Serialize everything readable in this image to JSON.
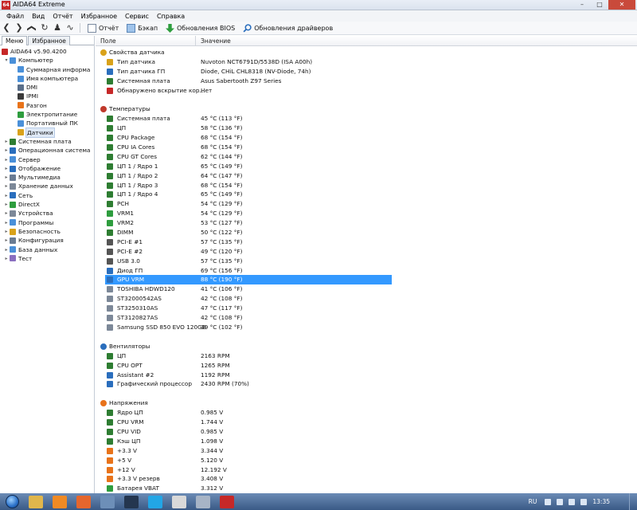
{
  "window": {
    "app_icon_text": "64",
    "title": "AIDA64 Extreme",
    "buttons": {
      "minimize": "–",
      "maximize": "□",
      "close": "✕"
    }
  },
  "menu": [
    "Файл",
    "Вид",
    "Отчёт",
    "Избранное",
    "Сервис",
    "Справка"
  ],
  "toolbar": {
    "nav": [
      "❮",
      "❯",
      "❯",
      "↻",
      "♟",
      "∿"
    ],
    "report": "Отчёт",
    "backup": "Бэкап",
    "bios_updates": "Обновления BIOS",
    "driver_updates": "Обновления драйверов"
  },
  "tabs": [
    "Меню",
    "Избранное"
  ],
  "tree": [
    {
      "label": "AIDA64 v5.90.4200",
      "depth": 0,
      "icon": "aida-icon",
      "color": "#c62828",
      "exp": ""
    },
    {
      "label": "Компьютер",
      "depth": 1,
      "icon": "computer-icon",
      "color": "#4a90d9",
      "exp": "▾"
    },
    {
      "label": "Суммарная информа",
      "depth": 2,
      "icon": "summary-icon",
      "color": "#4a90d9",
      "exp": ""
    },
    {
      "label": "Имя компьютера",
      "depth": 2,
      "icon": "computer-name-icon",
      "color": "#4a90d9",
      "exp": ""
    },
    {
      "label": "DMI",
      "depth": 2,
      "icon": "dmi-icon",
      "color": "#5a6f8a",
      "exp": ""
    },
    {
      "label": "IPMI",
      "depth": 2,
      "icon": "ipmi-icon",
      "color": "#3b3b3b",
      "exp": ""
    },
    {
      "label": "Разгон",
      "depth": 2,
      "icon": "flame-icon",
      "color": "#e8731a",
      "exp": ""
    },
    {
      "label": "Электропитание",
      "depth": 2,
      "icon": "power-icon",
      "color": "#2e9d3e",
      "exp": ""
    },
    {
      "label": "Портативный ПК",
      "depth": 2,
      "icon": "laptop-icon",
      "color": "#4a90d9",
      "exp": ""
    },
    {
      "label": "Датчики",
      "depth": 2,
      "icon": "sensor-icon",
      "color": "#d9a21a",
      "exp": "",
      "selected": true
    },
    {
      "label": "Системная плата",
      "depth": 1,
      "icon": "motherboard-icon",
      "color": "#2e7d32",
      "exp": "▸"
    },
    {
      "label": "Операционная система",
      "depth": 1,
      "icon": "os-icon",
      "color": "#2a6ebd",
      "exp": "▸"
    },
    {
      "label": "Сервер",
      "depth": 1,
      "icon": "server-icon",
      "color": "#4a90d9",
      "exp": "▸"
    },
    {
      "label": "Отображение",
      "depth": 1,
      "icon": "display-icon",
      "color": "#2a6ebd",
      "exp": "▸"
    },
    {
      "label": "Мультимедиа",
      "depth": 1,
      "icon": "multimedia-icon",
      "color": "#6a7c93",
      "exp": "▸"
    },
    {
      "label": "Хранение данных",
      "depth": 1,
      "icon": "storage-icon",
      "color": "#7c8898",
      "exp": "▸"
    },
    {
      "label": "Сеть",
      "depth": 1,
      "icon": "network-icon",
      "color": "#2a6ebd",
      "exp": "▸"
    },
    {
      "label": "DirectX",
      "depth": 1,
      "icon": "directx-icon",
      "color": "#2e9d3e",
      "exp": "▸"
    },
    {
      "label": "Устройства",
      "depth": 1,
      "icon": "devices-icon",
      "color": "#7c8898",
      "exp": "▸"
    },
    {
      "label": "Программы",
      "depth": 1,
      "icon": "programs-icon",
      "color": "#4a90d9",
      "exp": "▸"
    },
    {
      "label": "Безопасность",
      "depth": 1,
      "icon": "security-icon",
      "color": "#d9a21a",
      "exp": "▸"
    },
    {
      "label": "Конфигурация",
      "depth": 1,
      "icon": "config-icon",
      "color": "#6a7c93",
      "exp": "▸"
    },
    {
      "label": "База данных",
      "depth": 1,
      "icon": "database-icon",
      "color": "#4a90d9",
      "exp": "▸"
    },
    {
      "label": "Тест",
      "depth": 1,
      "icon": "test-icon",
      "color": "#8a6fc0",
      "exp": "▸"
    }
  ],
  "columns": {
    "field": "Поле",
    "value": "Значение"
  },
  "sections": [
    {
      "title": "Свойства датчика",
      "icon": "sensor-props-icon",
      "color": "#d9a21a",
      "rows": [
        {
          "field": "Тип датчика",
          "value": "Nuvoton NCT6791D/5538D  (ISA A00h)",
          "icon": "sensor-type-icon",
          "color": "#d9a21a"
        },
        {
          "field": "Тип датчика ГП",
          "value": "Diode, CHiL CHL8318  (NV-Diode, 74h)",
          "icon": "gpu-sensor-icon",
          "color": "#2a6ebd"
        },
        {
          "field": "Системная плата",
          "value": "Asus Sabertooth Z97 Series",
          "icon": "motherboard-icon",
          "color": "#2e7d32"
        },
        {
          "field": "Обнаружено вскрытие кор...",
          "value": "Нет",
          "icon": "chassis-icon",
          "color": "#c62828"
        }
      ]
    },
    {
      "title": "Температуры",
      "icon": "thermometer-icon",
      "color": "#c0392b",
      "rows": [
        {
          "field": "Системная плата",
          "value": "45 °C  (113 °F)",
          "icon": "motherboard-icon",
          "color": "#2e7d32"
        },
        {
          "field": "ЦП",
          "value": "58 °C  (136 °F)",
          "icon": "cpu-icon",
          "color": "#2e7d32"
        },
        {
          "field": "CPU Package",
          "value": "68 °C  (154 °F)",
          "icon": "cpu-icon",
          "color": "#2e7d32"
        },
        {
          "field": "CPU IA Cores",
          "value": "68 °C  (154 °F)",
          "icon": "cpu-icon",
          "color": "#2e7d32"
        },
        {
          "field": "CPU GT Cores",
          "value": "62 °C  (144 °F)",
          "icon": "cpu-icon",
          "color": "#2e7d32"
        },
        {
          "field": "ЦП 1 / Ядро 1",
          "value": "65 °C  (149 °F)",
          "icon": "cpu-icon",
          "color": "#2e7d32"
        },
        {
          "field": "ЦП 1 / Ядро 2",
          "value": "64 °C  (147 °F)",
          "icon": "cpu-icon",
          "color": "#2e7d32"
        },
        {
          "field": "ЦП 1 / Ядро 3",
          "value": "68 °C  (154 °F)",
          "icon": "cpu-icon",
          "color": "#2e7d32"
        },
        {
          "field": "ЦП 1 / Ядро 4",
          "value": "65 °C  (149 °F)",
          "icon": "cpu-icon",
          "color": "#2e7d32"
        },
        {
          "field": "PCH",
          "value": "54 °C  (129 °F)",
          "icon": "chip-icon",
          "color": "#2e7d32"
        },
        {
          "field": "VRM1",
          "value": "54 °C  (129 °F)",
          "icon": "vrm-icon",
          "color": "#2e9d3e"
        },
        {
          "field": "VRM2",
          "value": "53 °C  (127 °F)",
          "icon": "vrm-icon",
          "color": "#2e9d3e"
        },
        {
          "field": "DIMM",
          "value": "50 °C  (122 °F)",
          "icon": "memory-icon",
          "color": "#2e7d32"
        },
        {
          "field": "PCI-E #1",
          "value": "57 °C  (135 °F)",
          "icon": "pcie-icon",
          "color": "#555"
        },
        {
          "field": "PCI-E #2",
          "value": "49 °C  (120 °F)",
          "icon": "pcie-icon",
          "color": "#555"
        },
        {
          "field": "USB 3.0",
          "value": "57 °C  (135 °F)",
          "icon": "usb-icon",
          "color": "#555"
        },
        {
          "field": "Диод ГП",
          "value": "69 °C  (156 °F)",
          "icon": "gpu-icon",
          "color": "#2a6ebd"
        },
        {
          "field": "GPU VRM",
          "value": "88 °C  (190 °F)",
          "icon": "gpu-icon",
          "color": "#2a6ebd",
          "highlighted": true
        },
        {
          "field": "TOSHIBA HDWD120",
          "value": "41 °C  (106 °F)",
          "icon": "disk-icon",
          "color": "#7c8898"
        },
        {
          "field": "ST32000542AS",
          "value": "42 °C  (108 °F)",
          "icon": "disk-icon",
          "color": "#7c8898"
        },
        {
          "field": "ST3250310AS",
          "value": "47 °C  (117 °F)",
          "icon": "disk-icon",
          "color": "#7c8898"
        },
        {
          "field": "ST3120827AS",
          "value": "42 °C  (108 °F)",
          "icon": "disk-icon",
          "color": "#7c8898"
        },
        {
          "field": "Samsung SSD 850 EVO 120GB",
          "value": "39 °C  (102 °F)",
          "icon": "disk-icon",
          "color": "#7c8898"
        }
      ]
    },
    {
      "title": "Вентиляторы",
      "icon": "fan-icon",
      "color": "#2a6ebd",
      "rows": [
        {
          "field": "ЦП",
          "value": "2163 RPM",
          "icon": "cpu-icon",
          "color": "#2e7d32"
        },
        {
          "field": "CPU OPT",
          "value": "1265 RPM",
          "icon": "cpu-icon",
          "color": "#2e7d32"
        },
        {
          "field": "Assistant #2",
          "value": "1192 RPM",
          "icon": "fan-icon",
          "color": "#2a6ebd"
        },
        {
          "field": "Графический процессор",
          "value": "2430 RPM  (70%)",
          "icon": "gpu-icon",
          "color": "#2a6ebd"
        }
      ]
    },
    {
      "title": "Напряжения",
      "icon": "voltage-icon",
      "color": "#e8731a",
      "rows": [
        {
          "field": "Ядро ЦП",
          "value": "0.985 V",
          "icon": "cpu-icon",
          "color": "#2e7d32"
        },
        {
          "field": "CPU VRM",
          "value": "1.744 V",
          "icon": "cpu-icon",
          "color": "#2e7d32"
        },
        {
          "field": "CPU VID",
          "value": "0.985 V",
          "icon": "cpu-icon",
          "color": "#2e7d32"
        },
        {
          "field": "Кэш ЦП",
          "value": "1.098 V",
          "icon": "cpu-icon",
          "color": "#2e7d32"
        },
        {
          "field": "+3.3 V",
          "value": "3.344 V",
          "icon": "voltage-icon",
          "color": "#e8731a"
        },
        {
          "field": "+5 V",
          "value": "5.120 V",
          "icon": "voltage-icon",
          "color": "#e8731a"
        },
        {
          "field": "+12 V",
          "value": "12.192 V",
          "icon": "voltage-icon",
          "color": "#e8731a"
        },
        {
          "field": "+3.3 V резерв",
          "value": "3.408 V",
          "icon": "voltage-icon",
          "color": "#e8731a"
        },
        {
          "field": "Батарея VBAT",
          "value": "3.312 V",
          "icon": "battery-icon",
          "color": "#2e9d3e"
        }
      ]
    }
  ],
  "taskbar": {
    "apps": [
      {
        "name": "explorer-taskbar-icon",
        "color": "#e0b64c"
      },
      {
        "name": "media-player-taskbar-icon",
        "color": "#f08a24"
      },
      {
        "name": "firefox-taskbar-icon",
        "color": "#e5662d"
      },
      {
        "name": "app-taskbar-icon",
        "color": "#6d8fb8"
      },
      {
        "name": "steam-taskbar-icon",
        "color": "#24364f"
      },
      {
        "name": "skype-taskbar-icon",
        "color": "#22a6e6"
      },
      {
        "name": "yandex-taskbar-icon",
        "color": "#d9d9d9"
      },
      {
        "name": "tool-taskbar-icon",
        "color": "#a7b4c6"
      },
      {
        "name": "aida64-taskbar-icon",
        "color": "#c62828"
      }
    ],
    "lang": "RU",
    "time": "13:35"
  }
}
